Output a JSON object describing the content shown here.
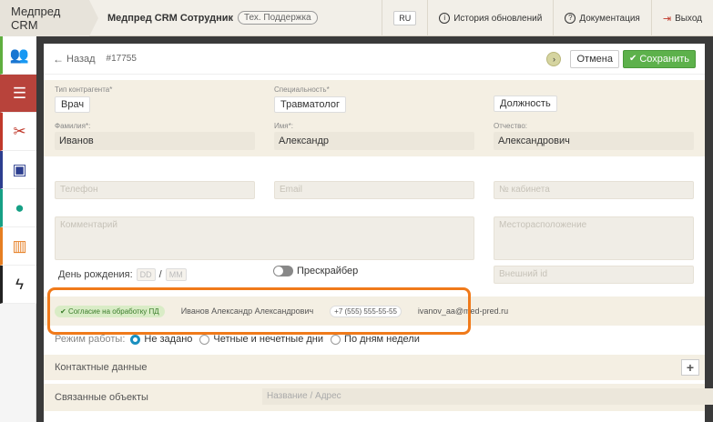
{
  "topbar": {
    "brand": "Медпред CRM",
    "title": "Медпред CRM Сотрудник",
    "badge": "Тех. Поддержка",
    "lang": "RU",
    "updates": "История обновлений",
    "docs": "Документация",
    "exit": "Выход"
  },
  "sidebar": {
    "icons": [
      "users-icon",
      "database-icon",
      "tools-icon",
      "calendar-check-icon",
      "map-marker-icon",
      "bar-chart-icon",
      "bolt-icon"
    ]
  },
  "header": {
    "back_label": "Назад",
    "record_id": "#17755",
    "cancel_label": "Отмена",
    "save_label": "Сохранить"
  },
  "form": {
    "contractor_type_label": "Тип контрагента*",
    "contractor_type_value": "Врач",
    "specialty_label": "Специальность*",
    "specialty_value": "Травматолог",
    "position_button": "Должность",
    "last_name_label": "Фамилия*:",
    "last_name_value": "Иванов",
    "first_name_label": "Имя*:",
    "first_name_value": "Александр",
    "patronymic_label": "Отчество:",
    "patronymic_value": "Александрович",
    "phone_placeholder": "Телефон",
    "email_placeholder": "Email",
    "cabinet_placeholder": "№ кабинета",
    "comment_placeholder": "Комментарий",
    "location_placeholder": "Месторасположение",
    "birthday_label": "День рождения:",
    "day_placeholder": "DD",
    "month_placeholder": "MM",
    "date_separator": "/",
    "prescriber_label": "Прескрайбер",
    "external_id_placeholder": "Внешний id"
  },
  "consent": {
    "badge": "Согласие на обработку ПД",
    "full_name": "Иванов Александр Александрович",
    "phone": "+7 (555) 555-55-55",
    "email": "ivanov_aa@med-pred.ru"
  },
  "work_mode": {
    "label": "Режим работы:",
    "options": [
      "Не задано",
      "Четные и нечетные дни",
      "По дням недели"
    ],
    "selected": "Не задано"
  },
  "sections": {
    "contacts": "Контактные данные",
    "linked": "Связанные объекты",
    "linked_placeholder": "Название / Адрес"
  },
  "colors": {
    "accent_green": "#5db14b",
    "highlight_orange": "#f07a1a",
    "radio_blue": "#1a8fbf"
  }
}
